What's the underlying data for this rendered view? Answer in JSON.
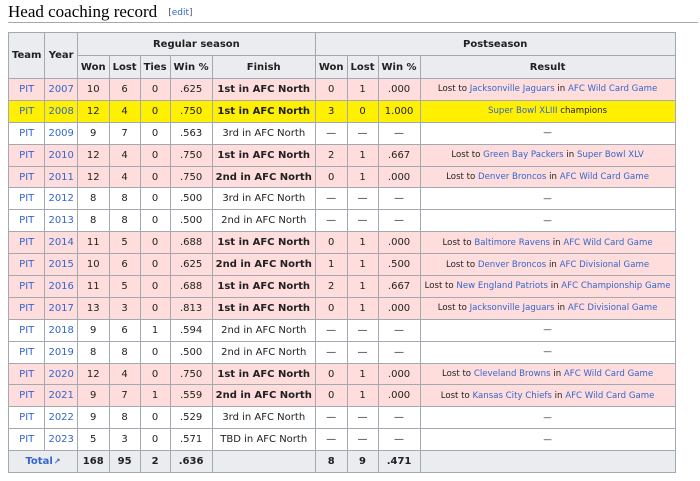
{
  "section": {
    "title": "Head coaching record",
    "edit_open": "[",
    "edit_label": "edit",
    "edit_close": "]"
  },
  "headers": {
    "team": "Team",
    "year": "Year",
    "regular_season": "Regular season",
    "postseason": "Postseason",
    "won": "Won",
    "lost": "Lost",
    "ties": "Ties",
    "win_pct": "Win %",
    "finish": "Finish",
    "result": "Result"
  },
  "rows": [
    {
      "team": "PIT",
      "year": "2007",
      "w": "10",
      "l": "6",
      "t": "0",
      "pct": ".625",
      "finish": "1st in AFC North",
      "finish_bold": true,
      "pw": "0",
      "pl": "1",
      "ppct": ".000",
      "result": [
        {
          "t": "Lost to "
        },
        {
          "t": "Jacksonville Jaguars",
          "link": true
        },
        {
          "t": " in "
        },
        {
          "t": "AFC Wild Card Game",
          "link": true
        }
      ],
      "style": "hl"
    },
    {
      "team": "PIT",
      "year": "2008",
      "w": "12",
      "l": "4",
      "t": "0",
      "pct": ".750",
      "finish": "1st in AFC North",
      "finish_bold": true,
      "pw": "3",
      "pl": "0",
      "ppct": "1.000",
      "result": [
        {
          "t": "Super Bowl XLIII",
          "link": true
        },
        {
          "t": " champions"
        }
      ],
      "style": "gold"
    },
    {
      "team": "PIT",
      "year": "2009",
      "w": "9",
      "l": "7",
      "t": "0",
      "pct": ".563",
      "finish": "3rd in AFC North",
      "finish_bold": false,
      "pw": "—",
      "pl": "—",
      "ppct": "—",
      "result": [
        {
          "t": "—"
        }
      ],
      "style": ""
    },
    {
      "team": "PIT",
      "year": "2010",
      "w": "12",
      "l": "4",
      "t": "0",
      "pct": ".750",
      "finish": "1st in AFC North",
      "finish_bold": true,
      "pw": "2",
      "pl": "1",
      "ppct": ".667",
      "result": [
        {
          "t": "Lost to "
        },
        {
          "t": "Green Bay Packers",
          "link": true
        },
        {
          "t": " in "
        },
        {
          "t": "Super Bowl XLV",
          "link": true
        }
      ],
      "style": "hl"
    },
    {
      "team": "PIT",
      "year": "2011",
      "w": "12",
      "l": "4",
      "t": "0",
      "pct": ".750",
      "finish": "2nd in AFC North",
      "finish_bold": true,
      "pw": "0",
      "pl": "1",
      "ppct": ".000",
      "result": [
        {
          "t": "Lost to "
        },
        {
          "t": "Denver Broncos",
          "link": true
        },
        {
          "t": " in "
        },
        {
          "t": "AFC Wild Card Game",
          "link": true
        }
      ],
      "style": "hl"
    },
    {
      "team": "PIT",
      "year": "2012",
      "w": "8",
      "l": "8",
      "t": "0",
      "pct": ".500",
      "finish": "3rd in AFC North",
      "finish_bold": false,
      "pw": "—",
      "pl": "—",
      "ppct": "—",
      "result": [
        {
          "t": "—"
        }
      ],
      "style": ""
    },
    {
      "team": "PIT",
      "year": "2013",
      "w": "8",
      "l": "8",
      "t": "0",
      "pct": ".500",
      "finish": "2nd in AFC North",
      "finish_bold": false,
      "pw": "—",
      "pl": "—",
      "ppct": "—",
      "result": [
        {
          "t": "—"
        }
      ],
      "style": ""
    },
    {
      "team": "PIT",
      "year": "2014",
      "w": "11",
      "l": "5",
      "t": "0",
      "pct": ".688",
      "finish": "1st in AFC North",
      "finish_bold": true,
      "pw": "0",
      "pl": "1",
      "ppct": ".000",
      "result": [
        {
          "t": "Lost to "
        },
        {
          "t": "Baltimore Ravens",
          "link": true
        },
        {
          "t": " in "
        },
        {
          "t": "AFC Wild Card Game",
          "link": true
        }
      ],
      "style": "hl"
    },
    {
      "team": "PIT",
      "year": "2015",
      "w": "10",
      "l": "6",
      "t": "0",
      "pct": ".625",
      "finish": "2nd in AFC North",
      "finish_bold": true,
      "pw": "1",
      "pl": "1",
      "ppct": ".500",
      "result": [
        {
          "t": "Lost to "
        },
        {
          "t": "Denver Broncos",
          "link": true
        },
        {
          "t": " in "
        },
        {
          "t": "AFC Divisional Game",
          "link": true
        }
      ],
      "style": "hl"
    },
    {
      "team": "PIT",
      "year": "2016",
      "w": "11",
      "l": "5",
      "t": "0",
      "pct": ".688",
      "finish": "1st in AFC North",
      "finish_bold": true,
      "pw": "2",
      "pl": "1",
      "ppct": ".667",
      "result": [
        {
          "t": "Lost to "
        },
        {
          "t": "New England Patriots",
          "link": true
        },
        {
          "t": " in "
        },
        {
          "t": "AFC Championship Game",
          "link": true
        }
      ],
      "style": "hl"
    },
    {
      "team": "PIT",
      "year": "2017",
      "w": "13",
      "l": "3",
      "t": "0",
      "pct": ".813",
      "finish": "1st in AFC North",
      "finish_bold": true,
      "pw": "0",
      "pl": "1",
      "ppct": ".000",
      "result": [
        {
          "t": "Lost to "
        },
        {
          "t": "Jacksonville Jaguars",
          "link": true
        },
        {
          "t": " in "
        },
        {
          "t": "AFC Divisional Game",
          "link": true
        }
      ],
      "style": "hl"
    },
    {
      "team": "PIT",
      "year": "2018",
      "w": "9",
      "l": "6",
      "t": "1",
      "pct": ".594",
      "finish": "2nd in AFC North",
      "finish_bold": false,
      "pw": "—",
      "pl": "—",
      "ppct": "—",
      "result": [
        {
          "t": "—"
        }
      ],
      "style": ""
    },
    {
      "team": "PIT",
      "year": "2019",
      "w": "8",
      "l": "8",
      "t": "0",
      "pct": ".500",
      "finish": "2nd in AFC North",
      "finish_bold": false,
      "pw": "—",
      "pl": "—",
      "ppct": "—",
      "result": [
        {
          "t": "—"
        }
      ],
      "style": ""
    },
    {
      "team": "PIT",
      "year": "2020",
      "w": "12",
      "l": "4",
      "t": "0",
      "pct": ".750",
      "finish": "1st in AFC North",
      "finish_bold": true,
      "pw": "0",
      "pl": "1",
      "ppct": ".000",
      "result": [
        {
          "t": "Lost to "
        },
        {
          "t": "Cleveland Browns",
          "link": true
        },
        {
          "t": " in "
        },
        {
          "t": "AFC Wild Card Game",
          "link": true
        }
      ],
      "style": "hl"
    },
    {
      "team": "PIT",
      "year": "2021",
      "w": "9",
      "l": "7",
      "t": "1",
      "pct": ".559",
      "finish": "2nd in AFC North",
      "finish_bold": true,
      "pw": "0",
      "pl": "1",
      "ppct": ".000",
      "result": [
        {
          "t": "Lost to "
        },
        {
          "t": "Kansas City Chiefs",
          "link": true
        },
        {
          "t": " in "
        },
        {
          "t": "AFC Wild Card Game",
          "link": true
        }
      ],
      "style": "hl"
    },
    {
      "team": "PIT",
      "year": "2022",
      "w": "9",
      "l": "8",
      "t": "0",
      "pct": ".529",
      "finish": "3rd in AFC North",
      "finish_bold": false,
      "pw": "—",
      "pl": "—",
      "ppct": "—",
      "result": [
        {
          "t": "—"
        }
      ],
      "style": ""
    },
    {
      "team": "PIT",
      "year": "2023",
      "w": "5",
      "l": "3",
      "t": "0",
      "pct": ".571",
      "finish": "TBD in AFC North",
      "finish_bold": false,
      "pw": "—",
      "pl": "—",
      "ppct": "—",
      "result": [
        {
          "t": "—"
        }
      ],
      "style": ""
    }
  ],
  "total": {
    "label": "Total",
    "external_icon": "external-link-icon",
    "w": "168",
    "l": "95",
    "t": "2",
    "pct": ".636",
    "pw": "8",
    "pl": "9",
    "ppct": ".471"
  },
  "colors": {
    "link": "#3366cc",
    "loss_row": "#ffdddd",
    "champion_row": "#ffef00",
    "header": "#eaecf0",
    "border": "#a2a9b1"
  }
}
